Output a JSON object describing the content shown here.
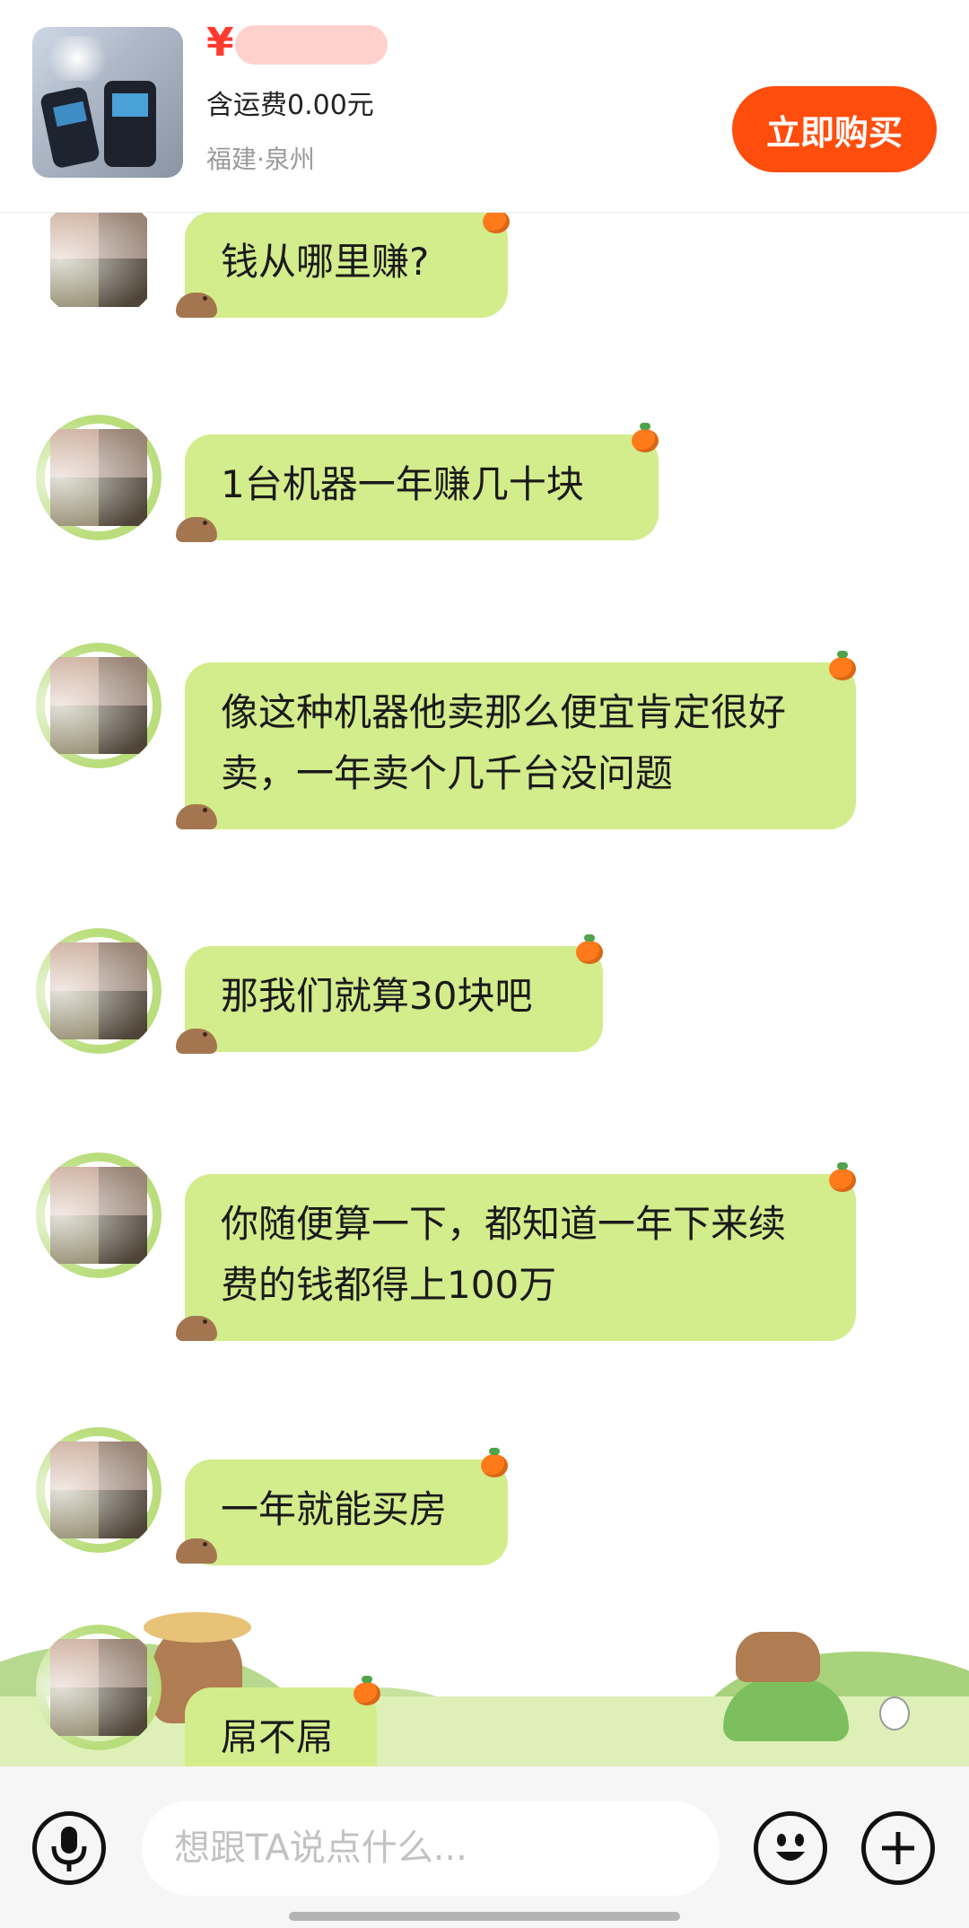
{
  "product": {
    "price_symbol": "¥",
    "shipping": "含运费0.00元",
    "location": "福建·泉州",
    "buy_button": "立即购买",
    "accent_color": "#ff4d0e"
  },
  "messages": [
    {
      "text": "钱从哪里赚?"
    },
    {
      "text": "1台机器一年赚几十块"
    },
    {
      "text": "像这种机器他卖那么便宜肯定很好卖，一年卖个几千台没问题"
    },
    {
      "text": "那我们就算30块吧"
    },
    {
      "text": "你随便算一下，都知道一年下来续费的钱都得上100万"
    },
    {
      "text": "一年就能买房"
    },
    {
      "text": "屌不屌"
    }
  ],
  "input_bar": {
    "placeholder": "想跟TA说点什么...",
    "icons": [
      "microphone-icon",
      "emoji-icon",
      "plus-icon"
    ]
  },
  "colors": {
    "bubble": "#d3ec8c",
    "price": "#ff3b30"
  }
}
